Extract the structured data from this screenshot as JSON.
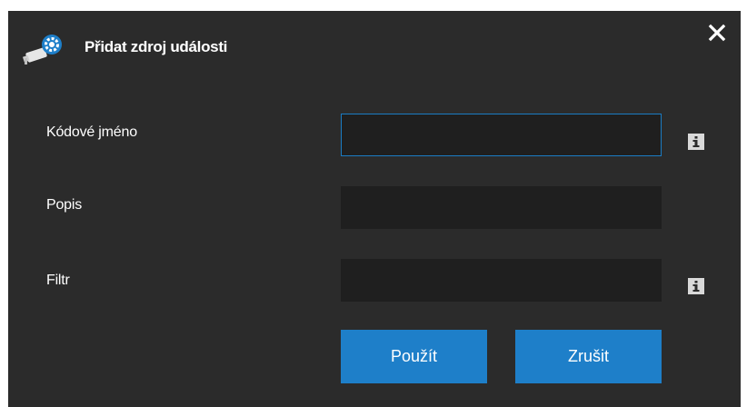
{
  "dialog": {
    "title": "Přidat zdroj události",
    "close_icon": "close-icon",
    "title_icon": "camera-gear-icon"
  },
  "form": {
    "codename": {
      "label": "Kódové jméno",
      "value": "",
      "info_icon": "info-icon"
    },
    "description": {
      "label": "Popis",
      "value": ""
    },
    "filter": {
      "label": "Filtr",
      "value": "",
      "info_icon": "info-icon"
    }
  },
  "buttons": {
    "apply_label": "Použít",
    "cancel_label": "Zrušit"
  },
  "colors": {
    "background": "#2b2b2b",
    "field": "#1f1f1f",
    "accent": "#1e7fc9",
    "focus_border": "#1a7cc4"
  }
}
